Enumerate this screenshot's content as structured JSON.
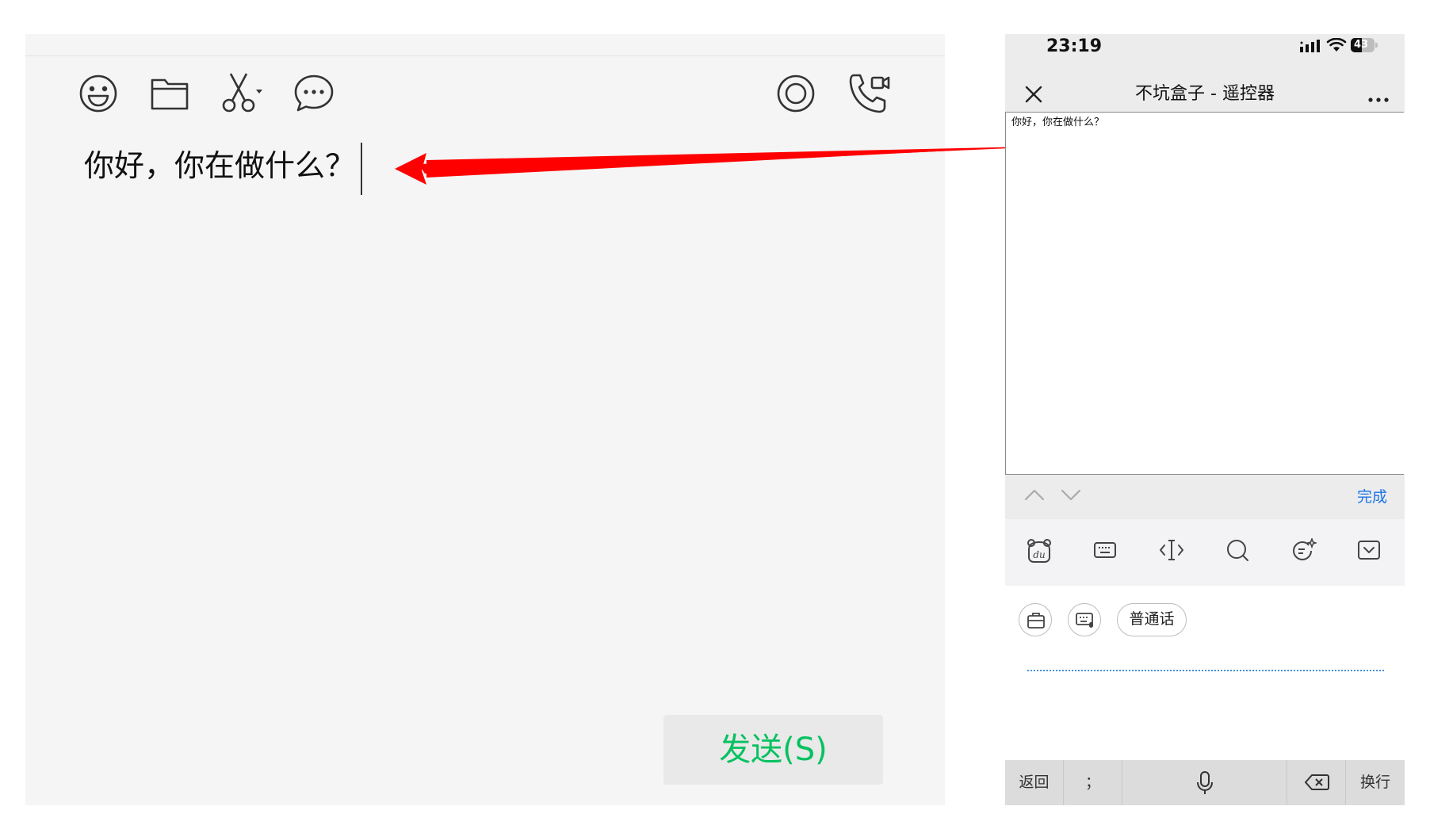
{
  "desktop": {
    "input_text": "你好，你在做什么？",
    "send_button": "发送(S)",
    "toolbar_icons": [
      "emoji-icon",
      "folder-icon",
      "scissors-icon",
      "chat-bubble-icon",
      "live-circle-icon",
      "video-call-icon"
    ]
  },
  "phone": {
    "status": {
      "time": "23:19",
      "battery": "43"
    },
    "nav": {
      "title": "不坑盒子 - 遥控器"
    },
    "remote_text": "你好，你在做什么？",
    "accessory": {
      "done": "完成"
    },
    "keyboard": {
      "toolbar_icons": [
        "du-logo-icon",
        "keyboard-icon",
        "cursor-move-icon",
        "search-icon",
        "edit-sparkle-icon",
        "collapse-keyboard-icon"
      ],
      "voice_mode": "普通话",
      "bottom_keys": {
        "back": "返回",
        "punct": "；",
        "newline": "换行"
      }
    }
  },
  "colors": {
    "send_green": "#07c160",
    "arrow_red": "#ff0000",
    "done_blue": "#1a73e8",
    "voice_dots": "#4a90d9"
  }
}
